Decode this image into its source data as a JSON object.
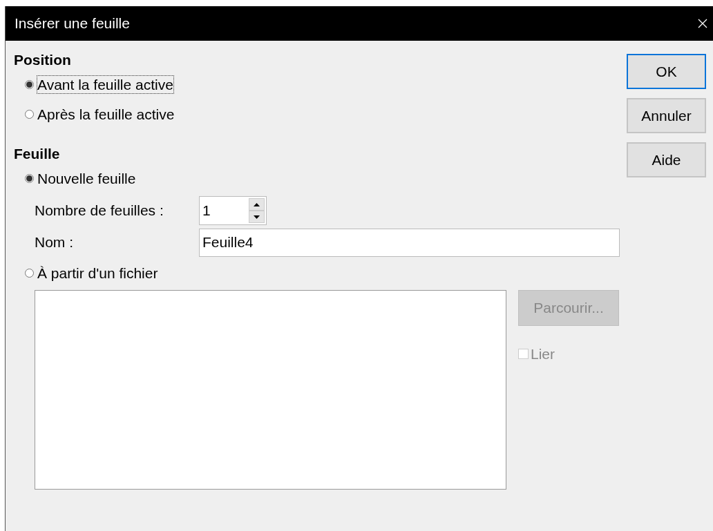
{
  "window": {
    "title": "Insérer une feuille"
  },
  "position": {
    "heading": "Position",
    "options": [
      {
        "label": "Avant la feuille active",
        "selected": true,
        "focused": true
      },
      {
        "label": "Après la feuille active",
        "selected": false,
        "focused": false
      }
    ]
  },
  "sheet": {
    "heading": "Feuille",
    "options": [
      {
        "label": "Nouvelle feuille",
        "selected": true,
        "focused": false
      },
      {
        "label": "À partir d'un fichier",
        "selected": false,
        "focused": false
      }
    ],
    "count": {
      "label": "Nombre de feuilles :",
      "value": "1"
    },
    "name": {
      "label": "Nom :",
      "value": "Feuille4"
    },
    "browse_button": {
      "label": "Parcourir...",
      "disabled": true
    },
    "link_checkbox": {
      "label": "Lier",
      "checked": false,
      "disabled": true
    }
  },
  "buttons": [
    {
      "label": "OK",
      "default": true
    },
    {
      "label": "Annuler",
      "default": false
    },
    {
      "label": "Aide",
      "default": false
    }
  ]
}
